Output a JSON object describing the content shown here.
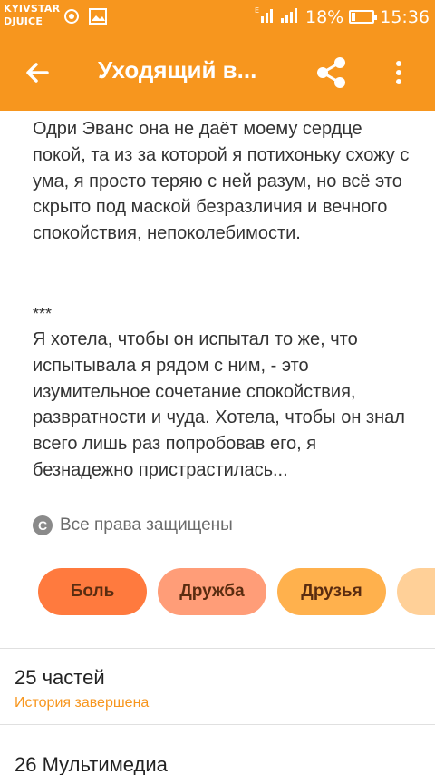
{
  "status_bar": {
    "carrier_line1": "KYIVSTAR",
    "carrier_line2": "DJUICE",
    "battery": "18%",
    "time": "15:36"
  },
  "toolbar": {
    "title": "Уходящий в...",
    "icons": [
      "arrow-back-icon",
      "share-icon",
      "more-vert-icon"
    ],
    "color": "#f7961e"
  },
  "story": {
    "paragraph1": "Одри Эванс она не даёт моему сердце покой, та из за которой я потихоньку схожу с ума, я просто теряю с ней разум, но всё это скрыто под маской безразличия и вечного спокойствия, непоколебимости.",
    "separator": "***",
    "paragraph2": "Я хотела, чтобы он испытал то же, что испытывала я рядом с ним, - это изумительное сочетание спокойствия, развратности и чуда. Хотела, чтобы он знал всего лишь раз попробовав его, я безнадежно пристрастилась..."
  },
  "rights": {
    "icon": "copyright-icon",
    "text": "Все права защищены"
  },
  "tags": [
    "Боль",
    "Дружба",
    "Друзья"
  ],
  "parts": {
    "title": "25 частей",
    "status": "История завершена"
  },
  "media": {
    "title": "26 Мультимедиа"
  }
}
